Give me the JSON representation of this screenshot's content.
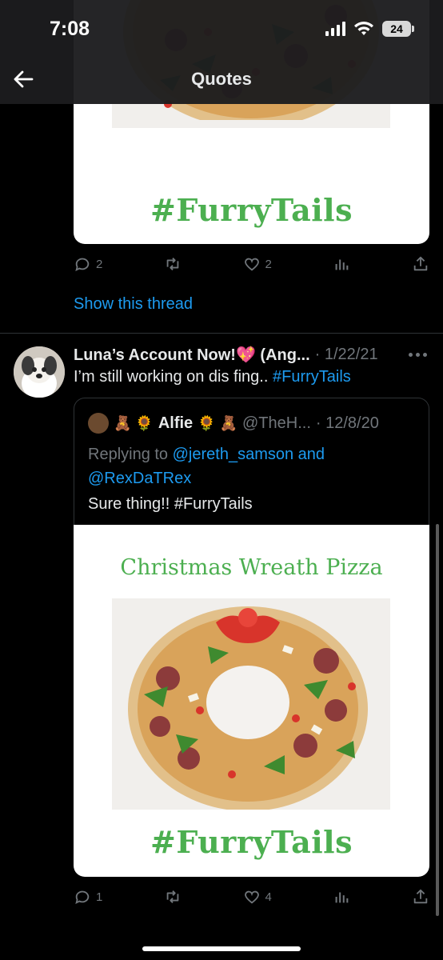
{
  "status_bar": {
    "time": "7:08",
    "battery": "24"
  },
  "header": {
    "title": "Quotes"
  },
  "top_card": {
    "tag": "#FurryTails"
  },
  "top_actions": {
    "replies": "2",
    "retweets": "",
    "likes": "2"
  },
  "show_thread": "Show this thread",
  "tweet": {
    "name": "Luna’s Account Now!💖 (Ang...",
    "date": "· 1/22/21",
    "text_prefix": "I’m still working on dis fing.. ",
    "hashtag": "#FurryTails"
  },
  "quote": {
    "emoji_left": "🧸 🌻",
    "name": "Alfie",
    "emoji_right": "🌻 🧸",
    "handle": "@TheH...",
    "date": "· 12/8/20",
    "replying_prefix": "Replying to ",
    "replying_users": "@jereth_samson and @RexDaTRex",
    "text": "Sure thing!! #FurryTails",
    "card_title": "Christmas Wreath Pizza",
    "card_tag": "#FurryTails"
  },
  "bottom_actions": {
    "replies": "1",
    "retweets": "",
    "likes": "4"
  },
  "colors": {
    "accent": "#1d9bf0",
    "tag_green": "#4caf50",
    "muted": "#71767b",
    "background": "#000000"
  }
}
